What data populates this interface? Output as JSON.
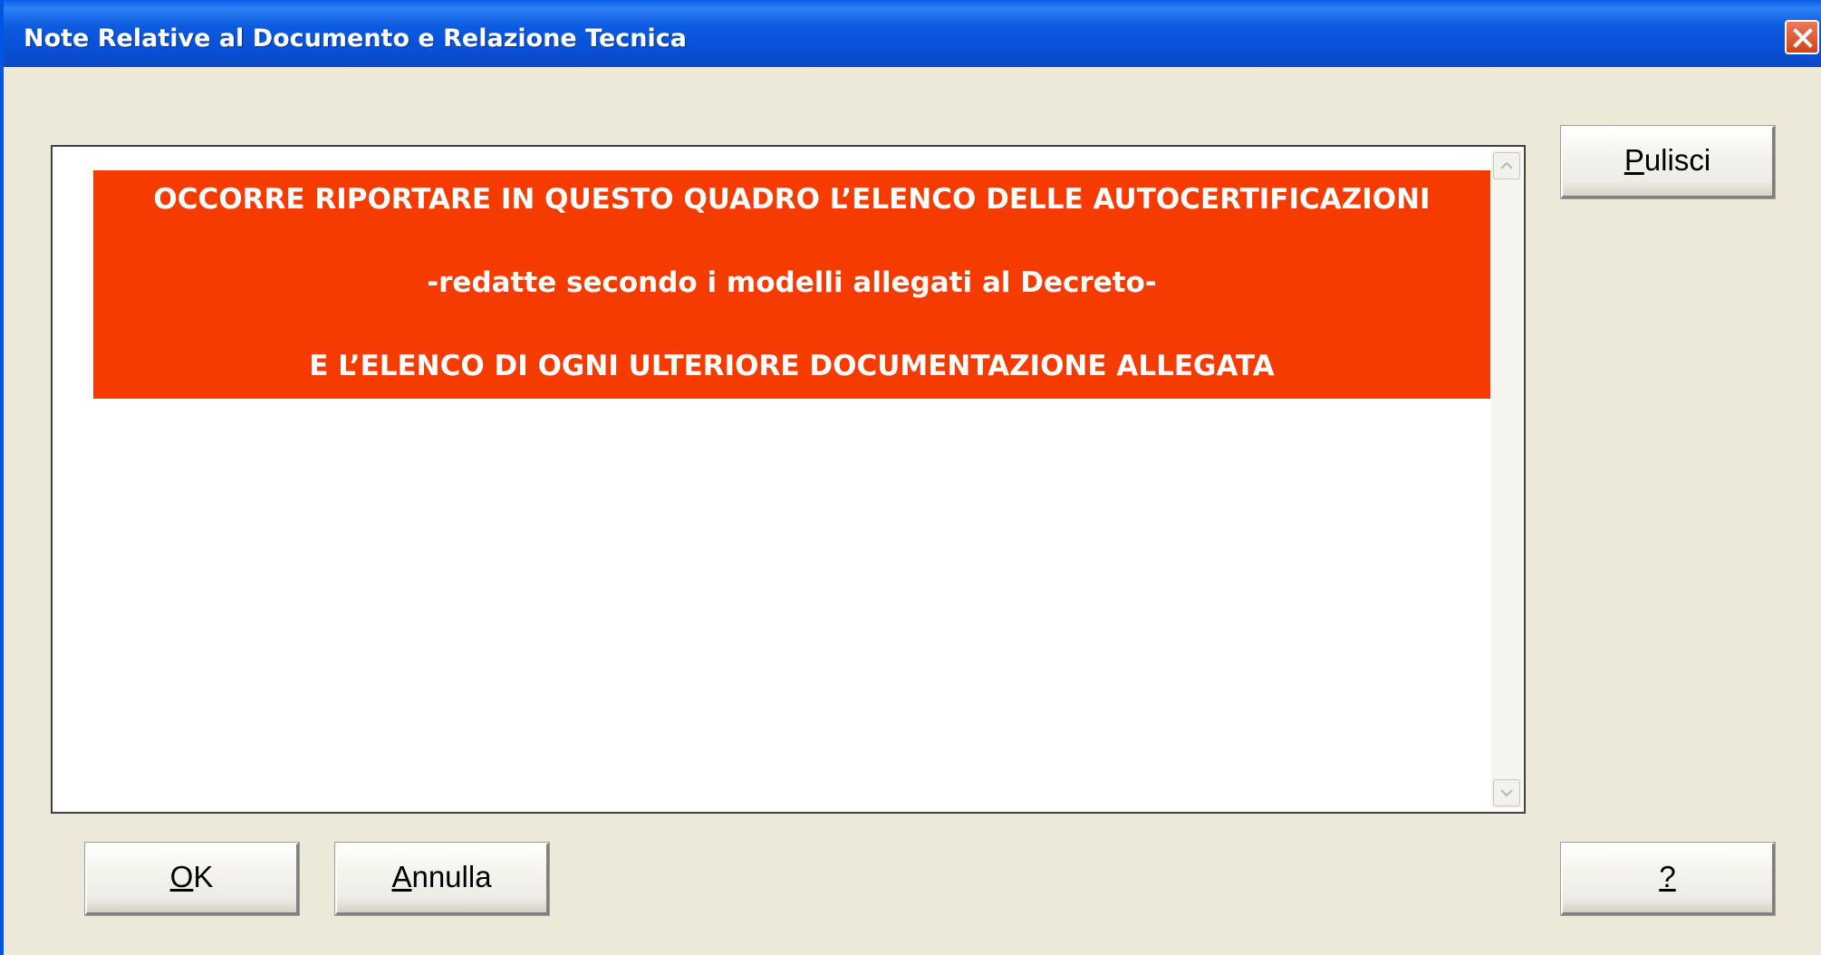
{
  "window": {
    "title": "Note Relative al Documento e Relazione Tecnica"
  },
  "notice": {
    "line1": "OCCORRE RIPORTARE IN QUESTO QUADRO L’ELENCO DELLE AUTOCERTIFICAZIONI",
    "line2": "-redatte secondo i modelli allegati al Decreto-",
    "line3": "E L’ELENCO DI OGNI ULTERIORE DOCUMENTAZIONE ALLEGATA",
    "background_color": "#F53B00"
  },
  "buttons": {
    "pulisci": {
      "mnemonic": "P",
      "rest": "ulisci"
    },
    "ok": {
      "mnemonic": "O",
      "rest": "K"
    },
    "annulla": {
      "mnemonic": "A",
      "rest": "nnulla"
    },
    "help": {
      "mnemonic": "?",
      "rest": ""
    }
  },
  "icons": {
    "close": "close-icon",
    "scroll_up": "scroll-up-arrow-icon",
    "scroll_down": "scroll-down-arrow-icon"
  },
  "colors": {
    "titlebar": "#0851D8",
    "dialog_background": "#ECE9D8",
    "close_button": "#D2431A"
  }
}
